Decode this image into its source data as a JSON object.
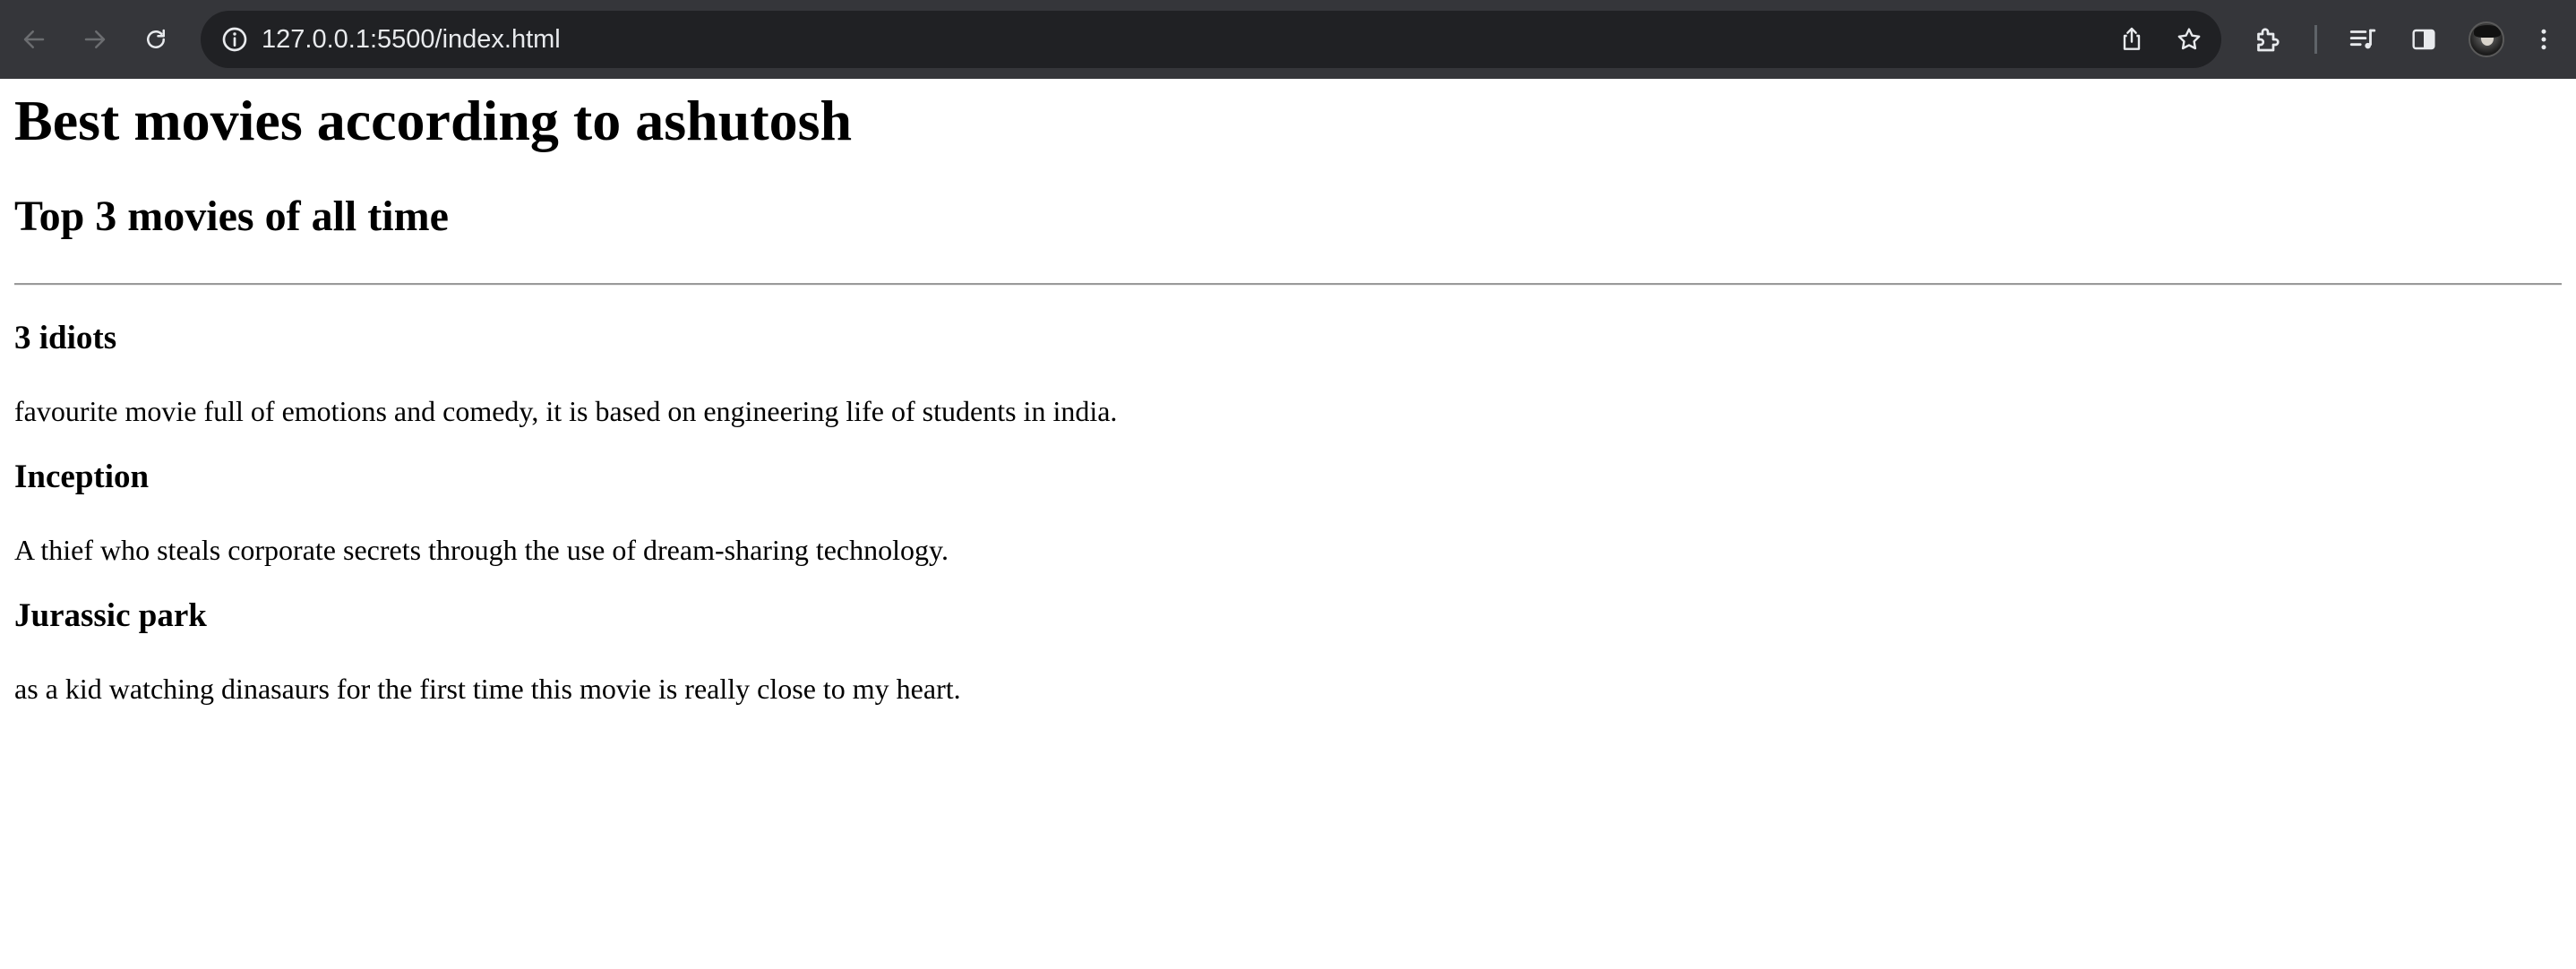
{
  "browser": {
    "url": "127.0.0.1:5500/index.html",
    "toolbar_color": "#35363a",
    "omnibox_color": "#202124",
    "icons": {
      "back": "arrow-left-icon",
      "forward": "arrow-right-icon",
      "reload": "reload-icon",
      "site_info": "info-circle-icon",
      "share": "share-icon",
      "bookmark": "star-icon",
      "extensions": "puzzle-icon",
      "media": "media-queue-icon",
      "side_panel": "side-panel-icon",
      "profile": "avatar",
      "menu": "vertical-dots-icon"
    }
  },
  "page": {
    "heading": "Best movies according to ashutosh",
    "subheading": "Top 3 movies of all time",
    "movies": [
      {
        "title": "3 idiots",
        "description": "favourite movie full of emotions and comedy, it is based on engineering life of students in india."
      },
      {
        "title": "Inception",
        "description": "A thief who steals corporate secrets through the use of dream-sharing technology."
      },
      {
        "title": "Jurassic park",
        "description": "as a kid watching dinasaurs for the first time this movie is really close to my heart."
      }
    ]
  }
}
